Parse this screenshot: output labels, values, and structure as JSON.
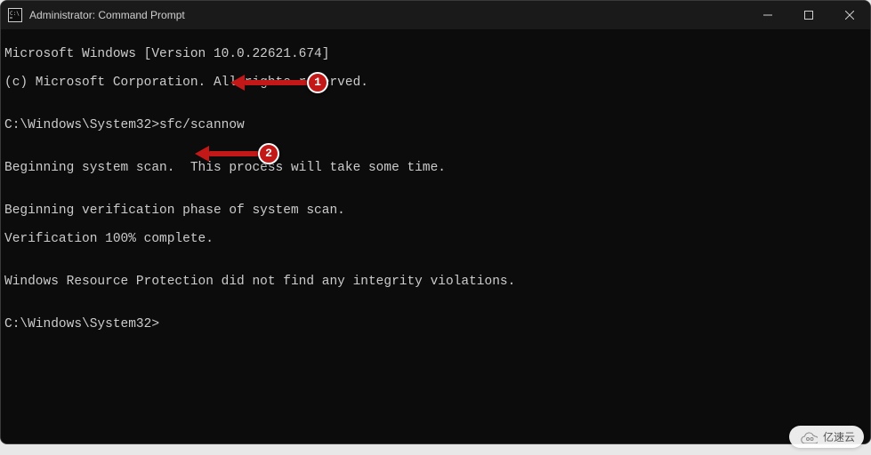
{
  "window": {
    "title": "Administrator: Command Prompt"
  },
  "controls": {
    "minimize": "minimize",
    "maximize": "maximize",
    "close": "close"
  },
  "terminal": {
    "banner1": "Microsoft Windows [Version 10.0.22621.674]",
    "banner2": "(c) Microsoft Corporation. All rights reserved.",
    "blank": "",
    "prompt1_path": "C:\\Windows\\System32>",
    "prompt1_cmd": "sfc/scannow",
    "scan_begin": "Beginning system scan.  This process will take some time.",
    "verify_begin": "Beginning verification phase of system scan.",
    "verify_done": "Verification 100% complete.",
    "result": "Windows Resource Protection did not find any integrity violations.",
    "prompt2_path": "C:\\Windows\\System32>"
  },
  "annotations": {
    "marker1": "1",
    "marker2": "2"
  },
  "watermark": {
    "text": "亿速云"
  }
}
